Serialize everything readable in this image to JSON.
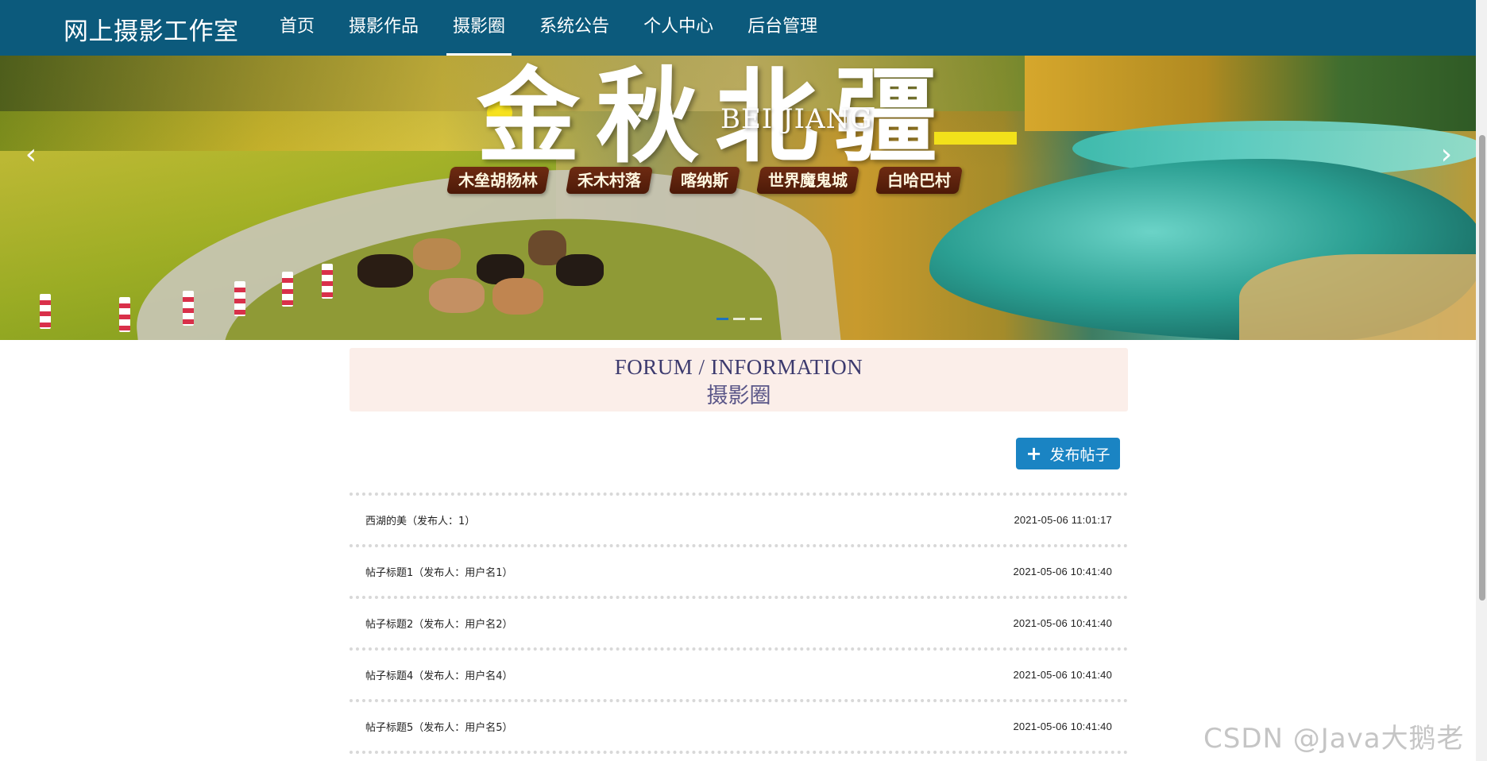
{
  "header": {
    "brand": "网上摄影工作室",
    "nav": [
      {
        "label": "首页"
      },
      {
        "label": "摄影作品"
      },
      {
        "label": "摄影圈"
      },
      {
        "label": "系统公告"
      },
      {
        "label": "个人中心"
      },
      {
        "label": "后台管理"
      }
    ],
    "active_nav": "摄影圈"
  },
  "banner": {
    "title_big": "金秋北疆",
    "title_sub": "BEI JIANG",
    "tags": [
      "木垒胡杨林",
      "禾木村落",
      "喀纳斯",
      "世界魔鬼城",
      "白哈巴村"
    ],
    "prev_arrow": "‹",
    "next_arrow": "›",
    "slide_count": 3,
    "active_slide": 1
  },
  "section": {
    "title_en": "FORUM / INFORMATION",
    "title_cn": "摄影圈"
  },
  "post_button": {
    "icon": "plus-icon",
    "plus": "+",
    "label": "发布帖子"
  },
  "posts": [
    {
      "title": "西湖的美（发布人：1）",
      "date": "2021-05-06 11:01:17"
    },
    {
      "title": "帖子标题1（发布人：用户名1）",
      "date": "2021-05-06 10:41:40"
    },
    {
      "title": "帖子标题2（发布人：用户名2）",
      "date": "2021-05-06 10:41:40"
    },
    {
      "title": "帖子标题4（发布人：用户名4）",
      "date": "2021-05-06 10:41:40"
    },
    {
      "title": "帖子标题5（发布人：用户名5）",
      "date": "2021-05-06 10:41:40"
    }
  ],
  "watermark": "CSDN @Java大鹅老师",
  "colors": {
    "navbar": "#0c5a7c",
    "accent_button": "#1a84c3",
    "section_bg": "#fbeee9",
    "section_text": "#3c3a6e"
  }
}
